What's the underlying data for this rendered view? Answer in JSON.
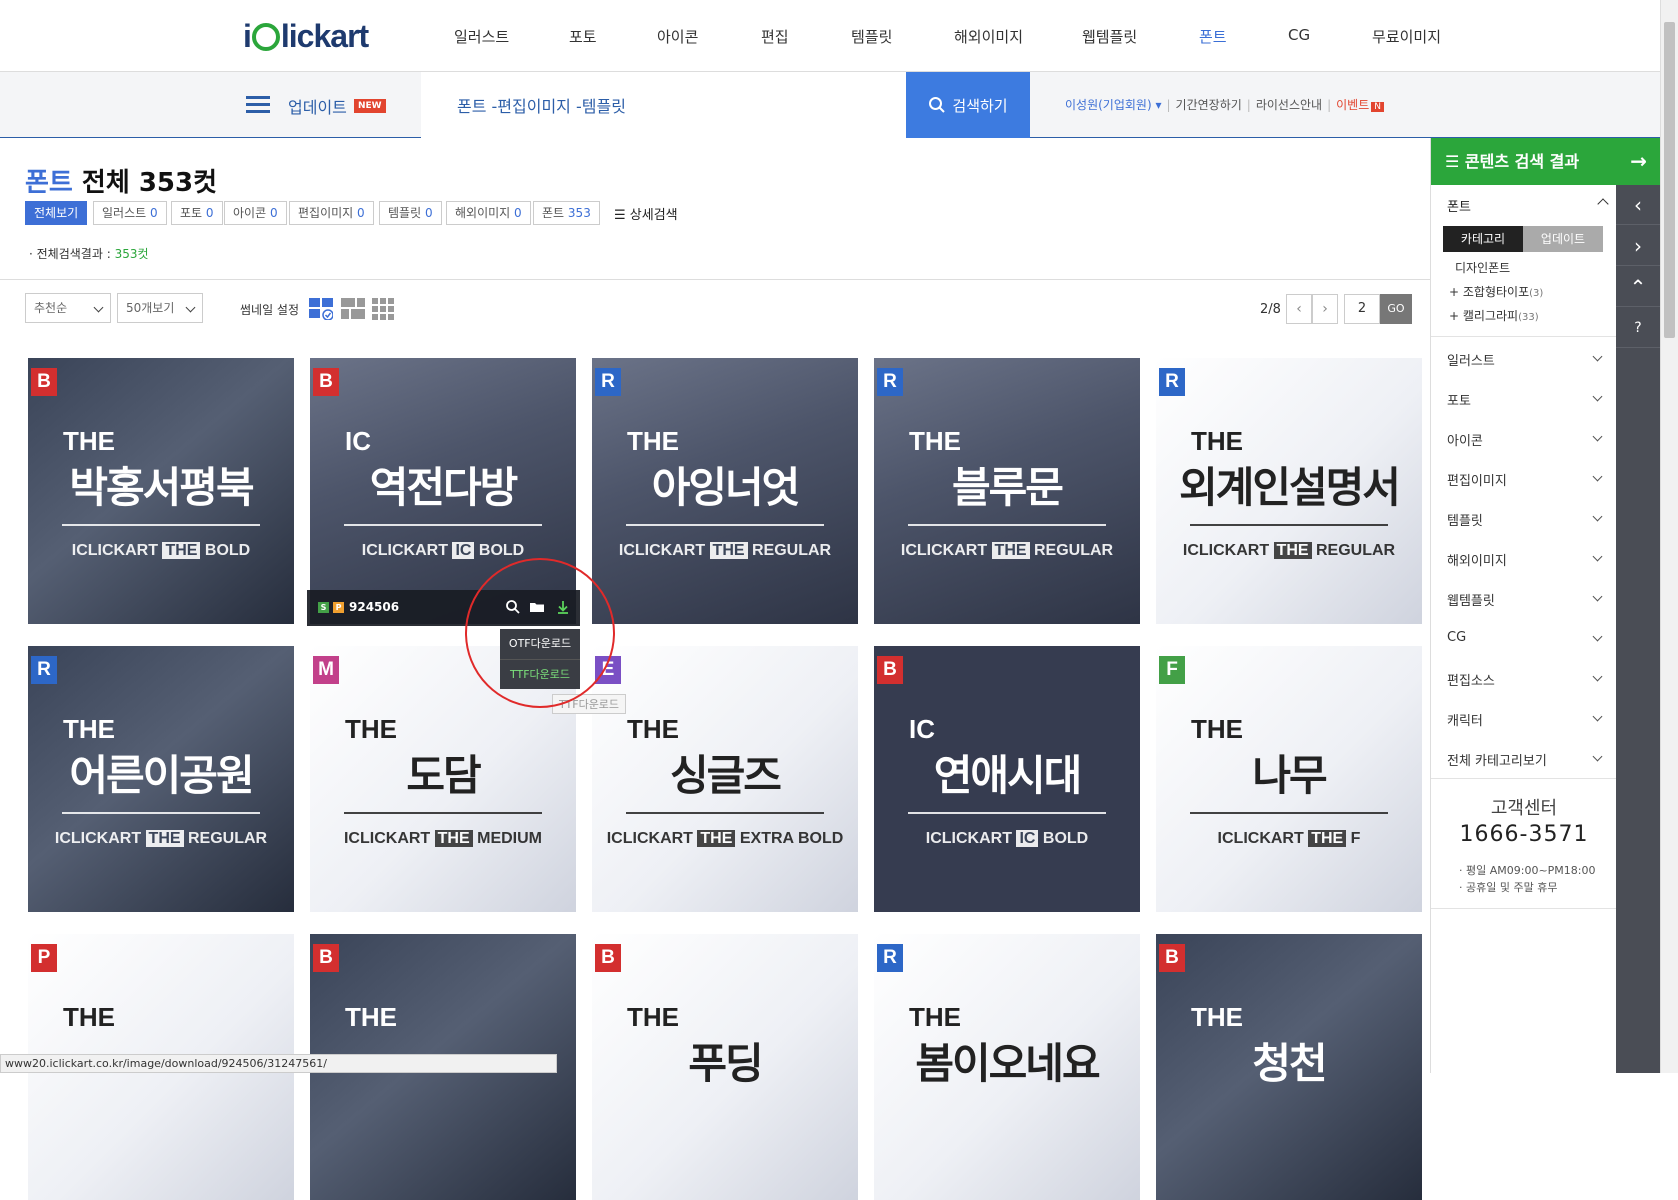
{
  "logo": {
    "pre": "i",
    "post": "lickart"
  },
  "gnav": [
    "일러스트",
    "포토",
    "아이콘",
    "편집",
    "템플릿",
    "해외이미지",
    "웹템플릿",
    "폰트",
    "CG",
    "무료이미지"
  ],
  "gnav_active": 7,
  "subnav": {
    "update_label": "업데이트",
    "new_badge": "NEW",
    "search_value": "폰트 -편집이미지 -템플릿",
    "search_button": "검색하기"
  },
  "utilnav": {
    "user": "이성원(기업회원)",
    "extend": "기간연장하기",
    "license": "라이선스안내",
    "event": "이벤트",
    "event_badge": "N"
  },
  "result": {
    "category": "폰트",
    "prefix": "전체",
    "count": "353컷"
  },
  "filters": [
    {
      "label": "전체보기",
      "count": ""
    },
    {
      "label": "일러스트",
      "count": "0"
    },
    {
      "label": "포토",
      "count": "0"
    },
    {
      "label": "아이콘",
      "count": "0"
    },
    {
      "label": "편집이미지",
      "count": "0"
    },
    {
      "label": "템플릿",
      "count": "0"
    },
    {
      "label": "해외이미지",
      "count": "0"
    },
    {
      "label": "폰트",
      "count": "353"
    }
  ],
  "advanced_search": "상세검색",
  "total": {
    "label": "전체검색결과 :",
    "count": "353컷"
  },
  "toolbar": {
    "sort": "추천순",
    "per_page": "50개보기",
    "thumb_label": "썸네일 설정"
  },
  "pager": {
    "current": "2",
    "total": "8",
    "input": "2",
    "go": "GO"
  },
  "cards": [
    {
      "badge": "B",
      "the": "THE",
      "name": "박홍서평북",
      "brand": "ICLICKART",
      "hl": "THE",
      "weight": "BOLD"
    },
    {
      "badge": "B",
      "the": "IC",
      "name": "역전다방",
      "brand": "ICLICKART",
      "hl": "IC",
      "weight": "BOLD"
    },
    {
      "badge": "R",
      "the": "THE",
      "name": "아잉너엇",
      "brand": "ICLICKART",
      "hl": "THE",
      "weight": "REGULAR"
    },
    {
      "badge": "R",
      "the": "THE",
      "name": "블루문",
      "brand": "ICLICKART",
      "hl": "THE",
      "weight": "REGULAR"
    },
    {
      "badge": "R",
      "the": "THE",
      "name": "외계인설명서",
      "brand": "ICLICKART",
      "hl": "THE",
      "weight": "REGULAR"
    },
    {
      "badge": "R",
      "the": "THE",
      "name": "어른이공원",
      "brand": "ICLICKART",
      "hl": "THE",
      "weight": "REGULAR"
    },
    {
      "badge": "M",
      "the": "THE",
      "name": "도담",
      "brand": "ICLICKART",
      "hl": "THE",
      "weight": "MEDIUM"
    },
    {
      "badge": "E",
      "the": "THE",
      "name": "싱글즈",
      "brand": "ICLICKART",
      "hl": "THE",
      "weight": "EXTRA BOLD"
    },
    {
      "badge": "B",
      "the": "IC",
      "name": "연애시대",
      "brand": "ICLICKART",
      "hl": "IC",
      "weight": "BOLD"
    },
    {
      "badge": "F",
      "the": "THE",
      "name": "나무",
      "brand": "ICLICKART",
      "hl": "THE",
      "weight": "F"
    },
    {
      "badge": "P",
      "the": "THE",
      "name": "",
      "brand": "",
      "hl": "",
      "weight": ""
    },
    {
      "badge": "B",
      "the": "THE",
      "name": "",
      "brand": "",
      "hl": "",
      "weight": ""
    },
    {
      "badge": "B",
      "the": "THE",
      "name": "푸딩",
      "brand": "",
      "hl": "",
      "weight": ""
    },
    {
      "badge": "R",
      "the": "THE",
      "name": "봄이오네요",
      "brand": "",
      "hl": "",
      "weight": ""
    },
    {
      "badge": "B",
      "the": "THE",
      "name": "청천",
      "brand": "",
      "hl": "",
      "weight": ""
    }
  ],
  "badge_colors": {
    "B": "#d32f2f",
    "R": "#2d67c7",
    "M": "#c2408a",
    "E": "#7a4fc4",
    "F": "#43a047",
    "P": "#d32f2f"
  },
  "hover": {
    "s": "S",
    "p": "P",
    "code": "924506"
  },
  "download_menu": {
    "otf": "OTF다운로드",
    "ttf": "TTF다운로드",
    "tooltip": "TTF다운로드"
  },
  "status_url": "www20.iclickart.co.kr/image/download/924506/31247561/",
  "sidebar": {
    "head": "콘텐츠 검색 결과",
    "font_label": "폰트",
    "tab_category": "카테고리",
    "tab_update": "업데이트",
    "design_font": "디자인폰트",
    "sub1": "조합형타이포",
    "sub1_count": "(3)",
    "sub2": "캘리그라피",
    "sub2_count": "(33)",
    "items": [
      "일러스트",
      "포토",
      "아이콘",
      "편집이미지",
      "템플릿",
      "해외이미지",
      "웹템플릿",
      "CG",
      "편집소스",
      "캐릭터",
      "전체 카테고리보기"
    ],
    "cs_title": "고객센터",
    "cs_phone": "1666-3571",
    "cs_hours": "평일 AM09:00~PM18:00",
    "cs_holiday": "공휴일 및 주말 휴무"
  }
}
